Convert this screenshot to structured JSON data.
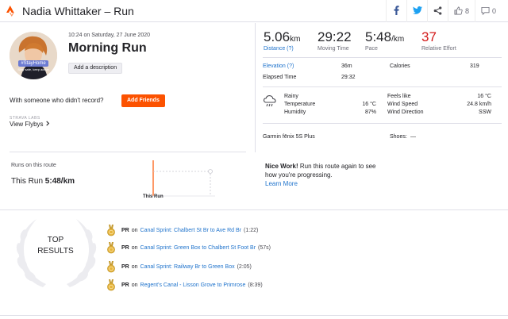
{
  "header": {
    "title": "Nadia Whittaker – Run",
    "kudos_count": "8",
    "comment_count": "0"
  },
  "athlete": {
    "badge_text": "#StayHome",
    "badge_subtext": "Stay safe, keep active"
  },
  "activity": {
    "datetime": "10:24 on Saturday, 27 June 2020",
    "title": "Morning Run",
    "add_description_label": "Add a description",
    "with_someone_text": "With someone who didn't record?",
    "add_friends_label": "Add Friends",
    "labs_label": "STRAVA LABS",
    "view_flybys_label": "View Flybys"
  },
  "stats": {
    "distance_value": "5.06",
    "distance_unit": "km",
    "distance_label": "Distance (?)",
    "moving_time_value": "29:22",
    "moving_time_label": "Moving Time",
    "pace_value": "5:48",
    "pace_unit": "/km",
    "pace_label": "Pace",
    "effort_value": "37",
    "effort_label": "Relative Effort"
  },
  "details": {
    "elevation_label": "Elevation (?)",
    "elevation_value": "36m",
    "calories_label": "Calories",
    "calories_value": "319",
    "elapsed_label": "Elapsed Time",
    "elapsed_value": "29:32"
  },
  "weather": {
    "condition": "Rainy",
    "temperature_label": "Temperature",
    "temperature_value": "16 °C",
    "humidity_label": "Humidity",
    "humidity_value": "87%",
    "feels_like_label": "Feels like",
    "feels_like_value": "16 °C",
    "wind_speed_label": "Wind Speed",
    "wind_speed_value": "24.8 km/h",
    "wind_direction_label": "Wind Direction",
    "wind_direction_value": "SSW"
  },
  "gear": {
    "device": "Garmin fēnix 5S Plus",
    "shoes_label": "Shoes:",
    "shoes_value": "—"
  },
  "route": {
    "runs_label": "Runs on this route",
    "this_run_label": "This Run",
    "this_run_pace": "5:48/km",
    "chart_caption": "This Run",
    "nice_work_bold": "Nice Work!",
    "nice_work_text": "Run this route again to see how you're progressing.",
    "learn_more_label": "Learn More"
  },
  "top_results": {
    "title_line1": "TOP",
    "title_line2": "RESULTS",
    "items": [
      {
        "badge": "PR",
        "on": "on",
        "segment": "Canal Sprint: Chalbert St Br to Ave Rd Br",
        "time": "(1:22)"
      },
      {
        "badge": "PR",
        "on": "on",
        "segment": "Canal Sprint: Green Box to Chalbert St Foot Br",
        "time": "(57s)"
      },
      {
        "badge": "PR",
        "on": "on",
        "segment": "Canal Sprint: Railway Br to Green Box",
        "time": "(2:05)"
      },
      {
        "badge": "PR",
        "on": "on",
        "segment": "Regent's Canal - Lisson Grove to Primrose",
        "time": "(8:39)"
      }
    ]
  },
  "colors": {
    "brand": "#fc5200",
    "link": "#1f73cc",
    "effort": "#d31a1a",
    "medal": "#e7b43a"
  },
  "icons": [
    "strava-logo-icon",
    "facebook-icon",
    "twitter-icon",
    "share-icon",
    "thumbs-up-icon",
    "comment-icon",
    "rain-cloud-icon",
    "chevron-right-icon",
    "medal-icon",
    "laurel-icon"
  ]
}
